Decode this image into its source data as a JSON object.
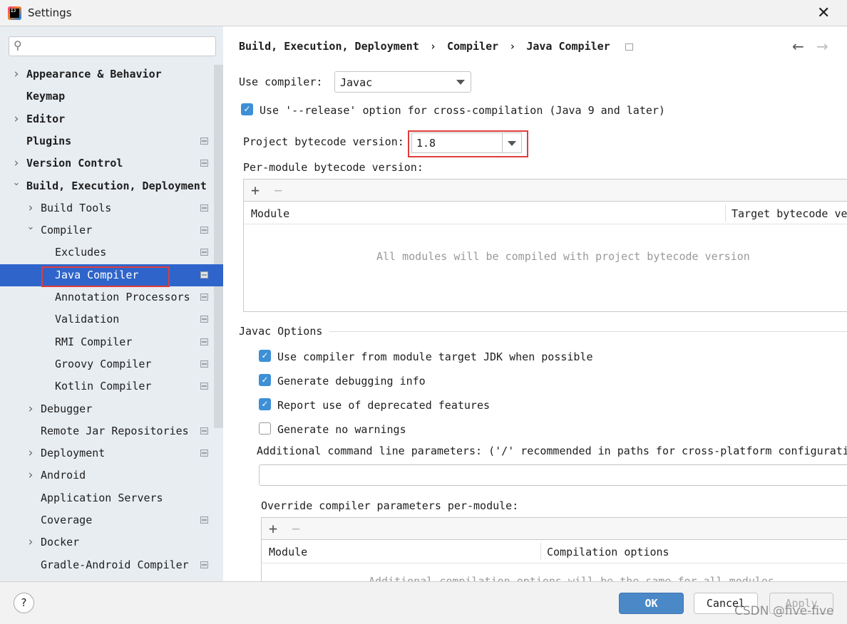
{
  "window": {
    "title": "Settings",
    "close_icon": "close-icon"
  },
  "search": {
    "placeholder": "",
    "value": ""
  },
  "sidebar": {
    "items": [
      {
        "label": "Appearance & Behavior",
        "expand": "collapsed",
        "bold": true
      },
      {
        "label": "Keymap",
        "bold": true
      },
      {
        "label": "Editor",
        "expand": "collapsed",
        "bold": true
      },
      {
        "label": "Plugins",
        "bold": true,
        "project": true
      },
      {
        "label": "Version Control",
        "expand": "collapsed",
        "bold": true,
        "project": true
      },
      {
        "label": "Build, Execution, Deployment",
        "expand": "expanded",
        "bold": true
      },
      {
        "label": "Build Tools",
        "expand": "collapsed",
        "project": true
      },
      {
        "label": "Compiler",
        "expand": "expanded",
        "project": true
      },
      {
        "label": "Excludes",
        "project": true
      },
      {
        "label": "Java Compiler",
        "project": true,
        "selected": true
      },
      {
        "label": "Annotation Processors",
        "project": true
      },
      {
        "label": "Validation",
        "project": true
      },
      {
        "label": "RMI Compiler",
        "project": true
      },
      {
        "label": "Groovy Compiler",
        "project": true
      },
      {
        "label": "Kotlin Compiler",
        "project": true
      },
      {
        "label": "Debugger",
        "expand": "collapsed"
      },
      {
        "label": "Remote Jar Repositories",
        "project": true
      },
      {
        "label": "Deployment",
        "expand": "collapsed",
        "project": true
      },
      {
        "label": "Android",
        "expand": "collapsed"
      },
      {
        "label": "Application Servers"
      },
      {
        "label": "Coverage",
        "project": true
      },
      {
        "label": "Docker",
        "expand": "collapsed"
      },
      {
        "label": "Gradle-Android Compiler",
        "project": true
      }
    ]
  },
  "breadcrumb": {
    "items": [
      "Build, Execution, Deployment",
      "Compiler",
      "Java Compiler"
    ],
    "sep": "›",
    "back": "←",
    "forward": "→"
  },
  "main": {
    "use_compiler_label": "Use compiler:",
    "use_compiler_value": "Javac",
    "release_option": {
      "label": "Use '--release' option for cross-compilation (Java 9 and later)",
      "checked": true
    },
    "bytecode_label": "Project bytecode version:",
    "bytecode_value": "1.8",
    "per_module_label": "Per-module bytecode version:",
    "table1": {
      "add": "+",
      "remove": "−",
      "columns": [
        "Module",
        "Target bytecode version"
      ],
      "empty": "All modules will be compiled with project bytecode version"
    },
    "javac_options_label": "Javac Options",
    "options": [
      {
        "label": "Use compiler from module target JDK when possible",
        "checked": true
      },
      {
        "label": "Generate debugging info",
        "checked": true
      },
      {
        "label": "Report use of deprecated features",
        "checked": true
      },
      {
        "label": "Generate no warnings",
        "checked": false
      }
    ],
    "additional_label": "Additional command line parameters:  ('/' recommended in paths for cross-platform configurations)",
    "additional_value": "",
    "override_label": "Override compiler parameters per-module:",
    "table2": {
      "add": "+",
      "remove": "−",
      "columns": [
        "Module",
        "Compilation options"
      ],
      "empty": "Additional compilation options will be the same for all modules"
    }
  },
  "footer": {
    "help": "?",
    "ok": "OK",
    "cancel": "Cancel",
    "apply": "Apply",
    "watermark": "CSDN @five-five"
  },
  "colors": {
    "accent": "#2f65ca",
    "highlight_box": "#e03c3c",
    "primary_button": "#4a88c8"
  }
}
